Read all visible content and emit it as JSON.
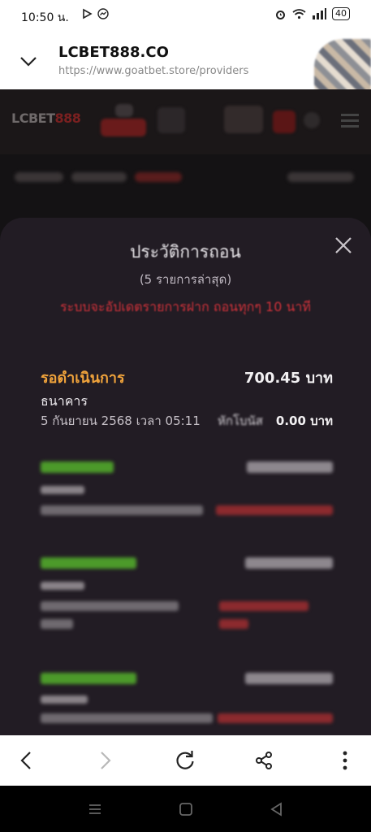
{
  "status_bar": {
    "time": "10:50 น.",
    "battery": "40"
  },
  "browser": {
    "site_title": "LCBET888.CO",
    "url": "https://www.goatbet.store/providers"
  },
  "site": {
    "logo_text_a": "LCBET",
    "logo_text_b": "888"
  },
  "modal": {
    "title": "ประวัติการถอน",
    "subtitle": "(5 รายการล่าสุด)",
    "notice": "ระบบจะอัปเดตรายการฝาก ถอนทุกๆ 10 นาที",
    "entries": [
      {
        "status": "รอดำเนินการ",
        "amount": "700.45 บาท",
        "method": "ธนาคาร",
        "datetime": "5 กันยายน 2568 เวลา 05:11",
        "bonus_label": "หักโบนัส",
        "bonus_value": "0.00 บาท"
      }
    ]
  },
  "colors": {
    "pending": "#f0a33b",
    "success_blurred": "#4c9a2a",
    "notice_red": "#d0323a",
    "modal_bg": "#221c24"
  }
}
